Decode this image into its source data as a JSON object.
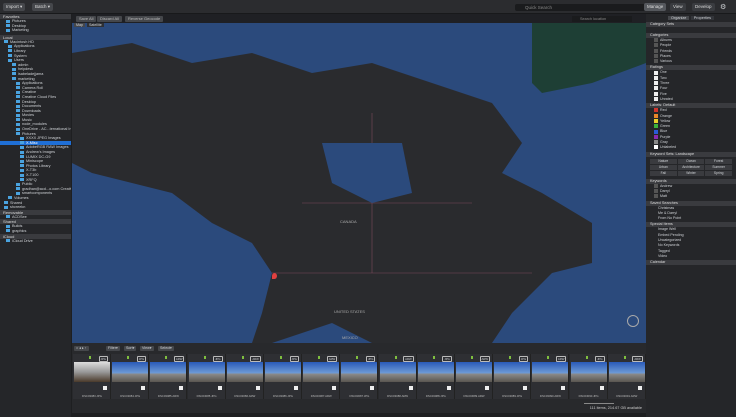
{
  "topbar": {
    "import": "Import",
    "batch": "Batch",
    "search_placeholder": "Quick Search",
    "modes": [
      "Manage",
      "View",
      "Develop"
    ]
  },
  "left": {
    "sections": {
      "favorites": "Favorites",
      "local": "Local",
      "removable": "Removable",
      "shared": "Shared",
      "icloud": "iCloud"
    },
    "favorites": [
      "Pictures",
      "Desktop",
      "Marketing"
    ],
    "local": [
      "Macintosh HD",
      "Applications",
      "Library",
      "System",
      "Users",
      "admin",
      "helpdesk",
      "isabeladejjama",
      "marketing",
      "Applications",
      "Camera Roll",
      "Creative",
      "Creative Cloud Files",
      "Desktop",
      "Documents",
      "Downloads",
      "Movies",
      "Music",
      "node_modules",
      "OneDrive - AC...ternational Inc",
      "Pictures",
      "XXXX JPEG Images",
      "X-Misc",
      "AdobeRGB RAW Images",
      "Andrew's Images",
      "LUMIX DC-G9",
      "Miniscope",
      "Photos Library",
      "X-T3b",
      "X-T100",
      "XRFQ",
      "Public",
      "gradhan@acd...o.com Creative",
      "smartcomponents",
      "Volumes",
      "Shared",
      "shcreekn"
    ],
    "removable": [
      "ACDSee"
    ],
    "shared": [
      "Builds",
      "graphics"
    ],
    "icloud": [
      "iCloud Drive"
    ]
  },
  "map": {
    "buttons": [
      "Save All",
      "Discard All",
      "Reverse Geocode"
    ],
    "types": [
      "Map",
      "Satellite"
    ],
    "search_placeholder": "Search location",
    "labels": [
      "CANADA",
      "UNITED STATES",
      "MEXICO"
    ]
  },
  "right": {
    "tabs": [
      "Organize",
      "Properties"
    ],
    "category_sets": "Category Sets",
    "categories_title": "Categories",
    "categories": [
      "Albums",
      "People",
      "Friends",
      "Places",
      "Various"
    ],
    "ratings_title": "Ratings",
    "ratings": [
      "One",
      "Two",
      "Three",
      "Four",
      "Five",
      "Unrated"
    ],
    "color_title": "Labels: Default",
    "colors": [
      {
        "name": "Red",
        "hex": "#d0342c"
      },
      {
        "name": "Orange",
        "hex": "#e8872a"
      },
      {
        "name": "Yellow",
        "hex": "#e8d12a"
      },
      {
        "name": "Green",
        "hex": "#3cb23a"
      },
      {
        "name": "Blue",
        "hex": "#2a5ad8"
      },
      {
        "name": "Purple",
        "hex": "#8a2ab0"
      },
      {
        "name": "Gray",
        "hex": "#888888"
      },
      {
        "name": "Unlabeled",
        "hex": "#ffffff"
      }
    ],
    "kwsets_title": "Keyword Sets: Landscape",
    "kwsets": [
      "Nature",
      "Ocean",
      "Forest",
      "Urban",
      "Architecture",
      "Summer",
      "Fall",
      "Winter",
      "Spring"
    ],
    "keywords_title": "Keywords",
    "keywords": [
      "Andrew",
      "Darryl",
      "Matt"
    ],
    "saved_title": "Saved Searches",
    "saved": [
      "Christmas",
      "Me & Darryl",
      "From No Point"
    ],
    "special_title": "Special Items",
    "special": [
      "Image Well",
      "Embed Pending",
      "Uncategorized",
      "No Keywords",
      "Tagged",
      "Video"
    ],
    "calendar": "Calendar"
  },
  "strip": {
    "buttons": [
      "Filter",
      "Sort",
      "View",
      "Select"
    ],
    "thumbs": [
      {
        "name": "DSC03083.JPG",
        "type": "JPG"
      },
      {
        "name": "DSC03084.JPG",
        "type": "JPG"
      },
      {
        "name": "DSC03085.ARW",
        "type": "ARW"
      },
      {
        "name": "DSC03085.JPG",
        "type": "JPG"
      },
      {
        "name": "DSC03086.ARW",
        "type": "ARW"
      },
      {
        "name": "DSC03086.JPG",
        "type": "JPG"
      },
      {
        "name": "DSC03087.ARW",
        "type": "ARW"
      },
      {
        "name": "DSC03087.JPG",
        "type": "JPG"
      },
      {
        "name": "DSC03088.ARW",
        "type": "ARW"
      },
      {
        "name": "DSC03088.JPG",
        "type": "JPG"
      },
      {
        "name": "DSC03089.ARW",
        "type": "ARW"
      },
      {
        "name": "DSC03089.JPG",
        "type": "JPG"
      },
      {
        "name": "DSC03090.ARW",
        "type": "ARW"
      },
      {
        "name": "DSC03090.JPG",
        "type": "JPG"
      },
      {
        "name": "DSC03091.ARW",
        "type": "ARW"
      }
    ]
  },
  "status": "111 items, 214.67 GB available"
}
